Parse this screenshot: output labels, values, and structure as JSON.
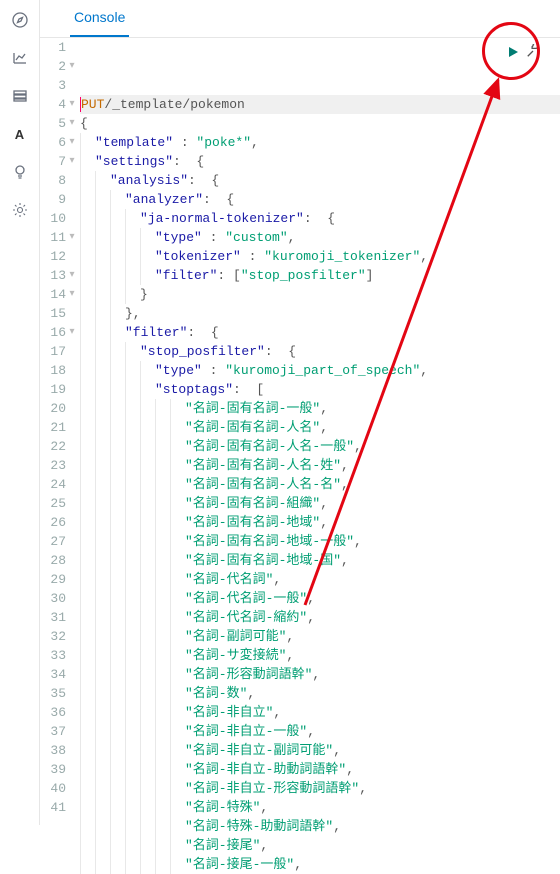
{
  "tabs": {
    "console": "Console"
  },
  "sidebar": {
    "icons": [
      "compass-icon",
      "chart-icon",
      "layers-icon",
      "letter-a-icon",
      "bulb-icon",
      "gear-icon"
    ]
  },
  "editor": {
    "method": "PUT",
    "path": "/_template/pokemon",
    "lines": [
      {
        "n": 1,
        "fold": "",
        "first": true,
        "html": [
          "method",
          "SP",
          "path"
        ]
      },
      {
        "n": 2,
        "fold": "▾",
        "indent": 0,
        "raw": "{"
      },
      {
        "n": 3,
        "fold": "",
        "indent": 1,
        "key": "template",
        "val": "poke*",
        "trail": ","
      },
      {
        "n": 4,
        "fold": "▾",
        "indent": 1,
        "key": "settings",
        "open": "{",
        "trail": ""
      },
      {
        "n": 5,
        "fold": "▾",
        "indent": 2,
        "key": "analysis",
        "open": "{",
        "trail": ""
      },
      {
        "n": 6,
        "fold": "▾",
        "indent": 3,
        "key": "analyzer",
        "open": "{",
        "trail": ""
      },
      {
        "n": 7,
        "fold": "▾",
        "indent": 4,
        "key": "ja-normal-tokenizer",
        "open": "{",
        "trail": ""
      },
      {
        "n": 8,
        "fold": "",
        "indent": 5,
        "key": "type",
        "val": "custom",
        "trail": ","
      },
      {
        "n": 9,
        "fold": "",
        "indent": 5,
        "key": "tokenizer",
        "val": "kuromoji_tokenizer",
        "trail": ","
      },
      {
        "n": 10,
        "fold": "",
        "indent": 5,
        "key": "filter",
        "arr": [
          "stop_posfilter"
        ]
      },
      {
        "n": 11,
        "fold": "▾",
        "indent": 4,
        "close": "}"
      },
      {
        "n": 12,
        "fold": "",
        "indent": 3,
        "close": "},"
      },
      {
        "n": 13,
        "fold": "▾",
        "indent": 3,
        "key": "filter",
        "open": "{",
        "trail": ""
      },
      {
        "n": 14,
        "fold": "▾",
        "indent": 4,
        "key": "stop_posfilter",
        "open": "{",
        "trail": ""
      },
      {
        "n": 15,
        "fold": "",
        "indent": 5,
        "key": "type",
        "val": "kuromoji_part_of_speech",
        "trail": ","
      },
      {
        "n": 16,
        "fold": "▾",
        "indent": 5,
        "key": "stoptags",
        "open": "[",
        "trail": ""
      },
      {
        "n": 17,
        "fold": "",
        "indent": 7,
        "arritem": "名詞-固有名詞-一般"
      },
      {
        "n": 18,
        "fold": "",
        "indent": 7,
        "arritem": "名詞-固有名詞-人名"
      },
      {
        "n": 19,
        "fold": "",
        "indent": 7,
        "arritem": "名詞-固有名詞-人名-一般"
      },
      {
        "n": 20,
        "fold": "",
        "indent": 7,
        "arritem": "名詞-固有名詞-人名-姓"
      },
      {
        "n": 21,
        "fold": "",
        "indent": 7,
        "arritem": "名詞-固有名詞-人名-名"
      },
      {
        "n": 22,
        "fold": "",
        "indent": 7,
        "arritem": "名詞-固有名詞-組織"
      },
      {
        "n": 23,
        "fold": "",
        "indent": 7,
        "arritem": "名詞-固有名詞-地域"
      },
      {
        "n": 24,
        "fold": "",
        "indent": 7,
        "arritem": "名詞-固有名詞-地域-一般"
      },
      {
        "n": 25,
        "fold": "",
        "indent": 7,
        "arritem": "名詞-固有名詞-地域-国"
      },
      {
        "n": 26,
        "fold": "",
        "indent": 7,
        "arritem": "名詞-代名詞"
      },
      {
        "n": 27,
        "fold": "",
        "indent": 7,
        "arritem": "名詞-代名詞-一般"
      },
      {
        "n": 28,
        "fold": "",
        "indent": 7,
        "arritem": "名詞-代名詞-縮約"
      },
      {
        "n": 29,
        "fold": "",
        "indent": 7,
        "arritem": "名詞-副詞可能"
      },
      {
        "n": 30,
        "fold": "",
        "indent": 7,
        "arritem": "名詞-サ変接続"
      },
      {
        "n": 31,
        "fold": "",
        "indent": 7,
        "arritem": "名詞-形容動詞語幹"
      },
      {
        "n": 32,
        "fold": "",
        "indent": 7,
        "arritem": "名詞-数"
      },
      {
        "n": 33,
        "fold": "",
        "indent": 7,
        "arritem": "名詞-非自立"
      },
      {
        "n": 34,
        "fold": "",
        "indent": 7,
        "arritem": "名詞-非自立-一般"
      },
      {
        "n": 35,
        "fold": "",
        "indent": 7,
        "arritem": "名詞-非自立-副詞可能"
      },
      {
        "n": 36,
        "fold": "",
        "indent": 7,
        "arritem": "名詞-非自立-助動詞語幹"
      },
      {
        "n": 37,
        "fold": "",
        "indent": 7,
        "arritem": "名詞-非自立-形容動詞語幹"
      },
      {
        "n": 38,
        "fold": "",
        "indent": 7,
        "arritem": "名詞-特殊"
      },
      {
        "n": 39,
        "fold": "",
        "indent": 7,
        "arritem": "名詞-特殊-助動詞語幹"
      },
      {
        "n": 40,
        "fold": "",
        "indent": 7,
        "arritem": "名詞-接尾"
      },
      {
        "n": 41,
        "fold": "",
        "indent": 7,
        "arritem": "名詞-接尾-一般"
      }
    ]
  },
  "actions": {
    "play": "run-request",
    "wrench": "settings"
  }
}
